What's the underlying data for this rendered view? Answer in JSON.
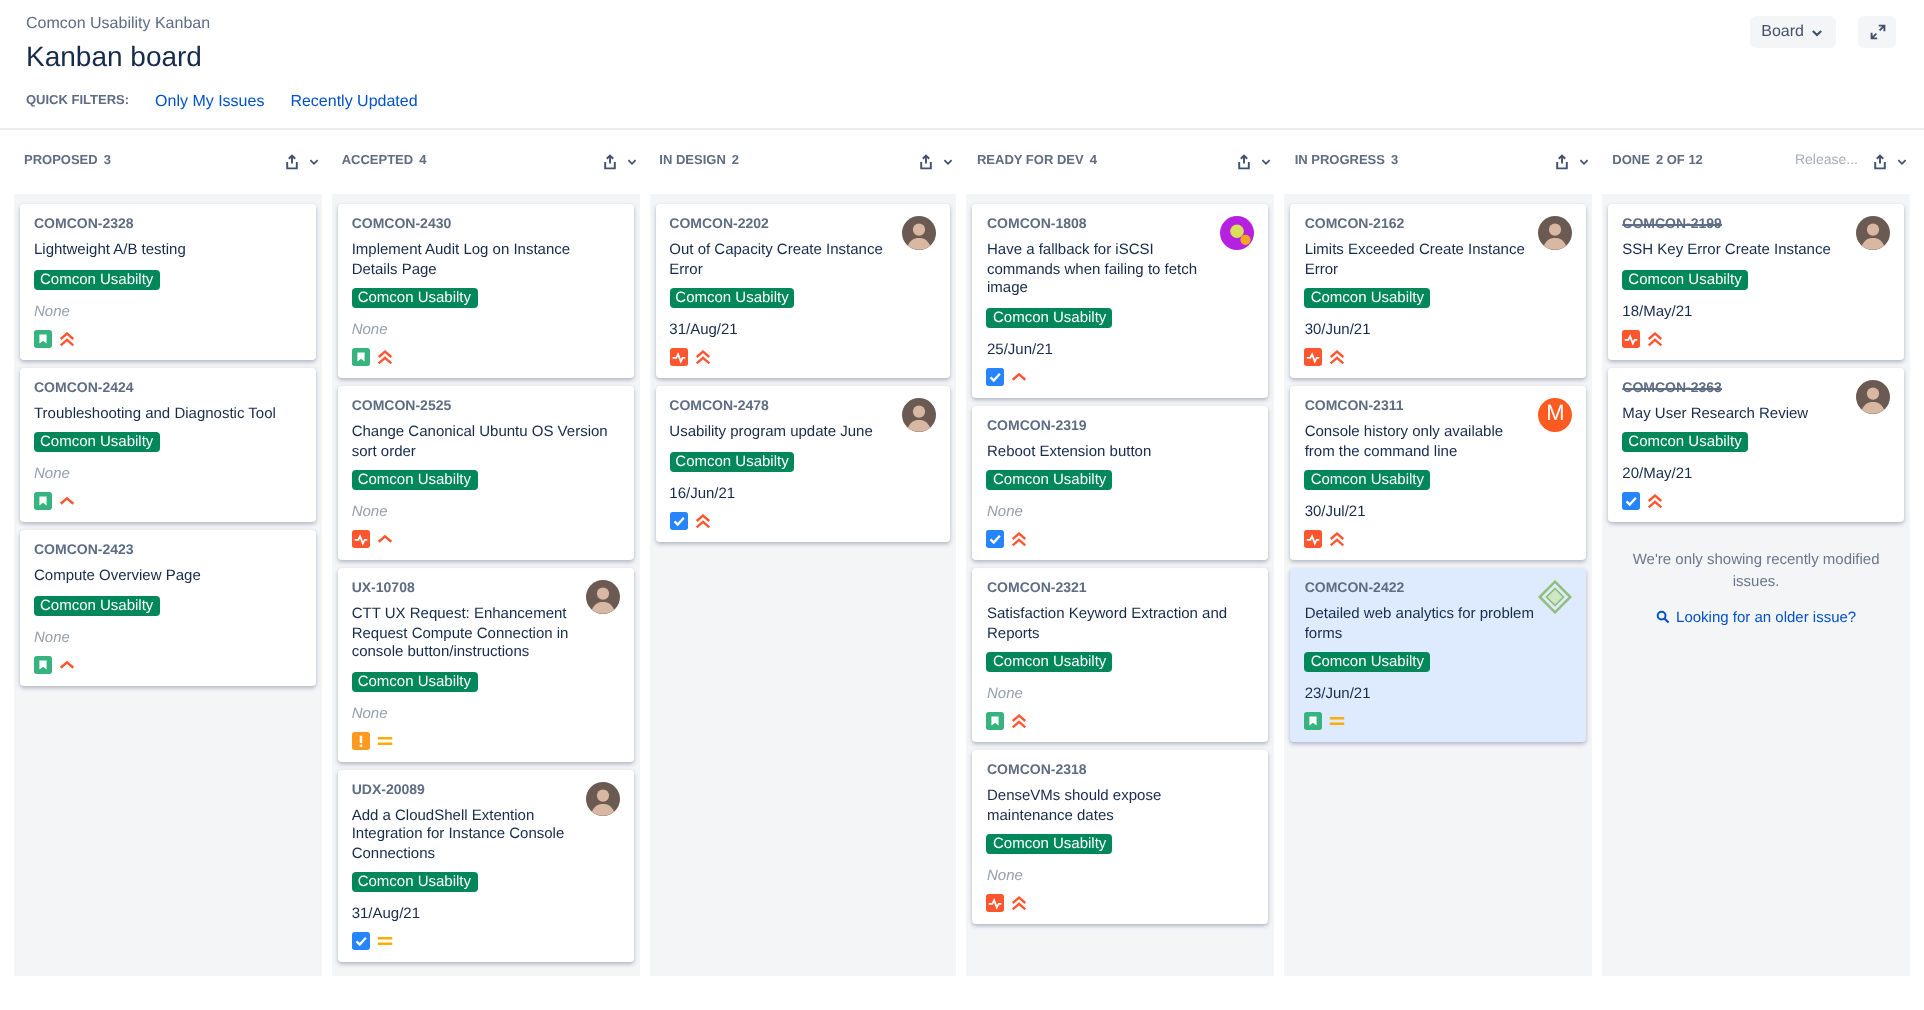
{
  "breadcrumb": "Comcon Usability Kanban",
  "title": "Kanban board",
  "board_button": "Board",
  "quick_filters": {
    "label": "QUICK FILTERS:",
    "items": [
      "Only My Issues",
      "Recently Updated"
    ]
  },
  "columns": [
    {
      "title": "PROPOSED",
      "count": "3",
      "cards": [
        {
          "key": "COMCON-2328",
          "done": false,
          "summary": "Lightweight A/B testing",
          "label": "Comcon Usabilty",
          "due": "None",
          "due_empty": true,
          "icons": [
            {
              "kind": "story"
            },
            {
              "kind": "highest"
            }
          ],
          "selected": false
        },
        {
          "key": "COMCON-2424",
          "done": false,
          "summary": "Troubleshooting and Diagnostic Tool",
          "label": "Comcon Usabilty",
          "due": "None",
          "due_empty": true,
          "icons": [
            {
              "kind": "story"
            },
            {
              "kind": "high"
            }
          ],
          "selected": false
        },
        {
          "key": "COMCON-2423",
          "done": false,
          "summary": "Compute Overview Page",
          "label": "Comcon Usabilty",
          "due": "None",
          "due_empty": true,
          "icons": [
            {
              "kind": "story"
            },
            {
              "kind": "high"
            }
          ],
          "selected": false
        }
      ]
    },
    {
      "title": "ACCEPTED",
      "count": "4",
      "cards": [
        {
          "key": "COMCON-2430",
          "done": false,
          "summary": "Implement Audit Log on Instance Details Page",
          "label": "Comcon Usabilty",
          "due": "None",
          "due_empty": true,
          "icons": [
            {
              "kind": "story"
            },
            {
              "kind": "highest"
            }
          ],
          "selected": false
        },
        {
          "key": "COMCON-2525",
          "done": false,
          "summary": "Change Canonical Ubuntu OS Version sort order",
          "label": "Comcon Usabilty",
          "due": "None",
          "due_empty": true,
          "icons": [
            {
              "kind": "bug"
            },
            {
              "kind": "high"
            }
          ],
          "selected": false
        },
        {
          "key": "UX-10708",
          "done": false,
          "summary": "CTT UX Request: Enhancement Request Compute Connection in console button/instructions",
          "label": "Comcon Usabilty",
          "due": "None",
          "due_empty": true,
          "icons": [
            {
              "kind": "warning"
            },
            {
              "kind": "medium"
            }
          ],
          "avatar": {
            "kind": "photo"
          },
          "selected": false
        },
        {
          "key": "UDX-20089",
          "done": false,
          "summary": "Add a CloudShell Extention Integration for Instance Console Connections",
          "label": "Comcon Usabilty",
          "due": "31/Aug/21",
          "due_empty": false,
          "icons": [
            {
              "kind": "task"
            },
            {
              "kind": "medium"
            }
          ],
          "avatar": {
            "kind": "photo"
          },
          "selected": false
        }
      ]
    },
    {
      "title": "IN DESIGN",
      "count": "2",
      "cards": [
        {
          "key": "COMCON-2202",
          "done": false,
          "summary": "Out of Capacity Create Instance Error",
          "label": "Comcon Usabilty",
          "due": "31/Aug/21",
          "due_empty": false,
          "icons": [
            {
              "kind": "bug"
            },
            {
              "kind": "highest"
            }
          ],
          "avatar": {
            "kind": "photo"
          },
          "selected": false
        },
        {
          "key": "COMCON-2478",
          "done": false,
          "summary": "Usability program update June",
          "label": "Comcon Usabilty",
          "due": "16/Jun/21",
          "due_empty": false,
          "icons": [
            {
              "kind": "task"
            },
            {
              "kind": "highest"
            }
          ],
          "avatar": {
            "kind": "photo"
          },
          "selected": false
        }
      ]
    },
    {
      "title": "READY FOR DEV",
      "count": "4",
      "cards": [
        {
          "key": "COMCON-1808",
          "done": false,
          "summary": "Have a fallback for iSCSI commands when failing to fetch image",
          "label": "Comcon Usabilty",
          "due": "25/Jun/21",
          "due_empty": false,
          "icons": [
            {
              "kind": "task"
            },
            {
              "kind": "high"
            }
          ],
          "avatar": {
            "kind": "colorful"
          },
          "selected": false
        },
        {
          "key": "COMCON-2319",
          "done": false,
          "summary": "Reboot Extension button",
          "label": "Comcon Usabilty",
          "due": "None",
          "due_empty": true,
          "icons": [
            {
              "kind": "task"
            },
            {
              "kind": "highest"
            }
          ],
          "selected": false
        },
        {
          "key": "COMCON-2321",
          "done": false,
          "summary": "Satisfaction Keyword Extraction and Reports",
          "label": "Comcon Usabilty",
          "due": "None",
          "due_empty": true,
          "icons": [
            {
              "kind": "story"
            },
            {
              "kind": "highest"
            }
          ],
          "selected": false
        },
        {
          "key": "COMCON-2318",
          "done": false,
          "summary": "DenseVMs should expose maintenance dates",
          "label": "Comcon Usabilty",
          "due": "None",
          "due_empty": true,
          "icons": [
            {
              "kind": "bug"
            },
            {
              "kind": "highest"
            }
          ],
          "selected": false
        }
      ]
    },
    {
      "title": "IN PROGRESS",
      "count": "3",
      "cards": [
        {
          "key": "COMCON-2162",
          "done": false,
          "summary": "Limits Exceeded Create Instance Error",
          "label": "Comcon Usabilty",
          "due": "30/Jun/21",
          "due_empty": false,
          "icons": [
            {
              "kind": "bug"
            },
            {
              "kind": "highest"
            }
          ],
          "avatar": {
            "kind": "photo"
          },
          "selected": false
        },
        {
          "key": "COMCON-2311",
          "done": false,
          "summary": "Console history only available from the command line",
          "label": "Comcon Usabilty",
          "due": "30/Jul/21",
          "due_empty": false,
          "icons": [
            {
              "kind": "bug"
            },
            {
              "kind": "highest"
            }
          ],
          "avatar": {
            "kind": "letter",
            "text": "M"
          },
          "selected": false
        },
        {
          "key": "COMCON-2422",
          "done": false,
          "summary": "Detailed web analytics for problem forms",
          "label": "Comcon Usabilty",
          "due": "23/Jun/21",
          "due_empty": false,
          "icons": [
            {
              "kind": "story"
            },
            {
              "kind": "medium"
            }
          ],
          "avatar": {
            "kind": "logo"
          },
          "selected": true
        }
      ]
    },
    {
      "title": "DONE",
      "count": "2 OF 12",
      "release_placeholder": "Release...",
      "note": "We're only showing recently modified issues.",
      "link": "Looking for an older issue?",
      "cards": [
        {
          "key": "COMCON-2199",
          "done": true,
          "summary": "SSH Key Error Create Instance",
          "label": "Comcon Usabilty",
          "due": "18/May/21",
          "due_empty": false,
          "icons": [
            {
              "kind": "bug"
            },
            {
              "kind": "highest"
            }
          ],
          "avatar": {
            "kind": "photo"
          },
          "selected": false
        },
        {
          "key": "COMCON-2363",
          "done": true,
          "summary": "May User Research Review",
          "label": "Comcon Usabilty",
          "due": "20/May/21",
          "due_empty": false,
          "icons": [
            {
              "kind": "task"
            },
            {
              "kind": "highest"
            }
          ],
          "avatar": {
            "kind": "photo"
          },
          "selected": false
        }
      ]
    }
  ]
}
